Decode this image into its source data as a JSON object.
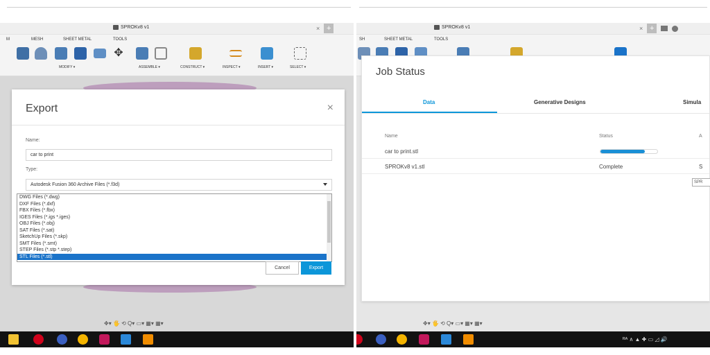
{
  "left_window": {
    "doc_title": "SPROKv8 v1",
    "close_glyph": "×",
    "new_tab_glyph": "+",
    "menu": [
      "M",
      "MESH",
      "SHEET METAL",
      "TOOLS"
    ],
    "toolbar_groups": [
      "MODIFY ▾",
      "ASSEMBLE ▾",
      "CONSTRUCT ▾",
      "INSPECT ▾",
      "INSERT ▾",
      "SELECT ▾"
    ],
    "nav_tools": "✥▾ 🖐 ⟲ Q▾ ▭▾ ▦▾ ▦▾"
  },
  "export_dialog": {
    "title": "Export",
    "close": "×",
    "name_label": "Name:",
    "name_value": "car to print",
    "type_label": "Type:",
    "type_value": "Autodesk Fusion 360 Archive Files (*.f3d)",
    "options": [
      "DWG Files (*.dwg)",
      "DXF Files (*.dxf)",
      "FBX Files (*.fbx)",
      "IGES Files (*.igs *.iges)",
      "OBJ Files (*.obj)",
      "SAT Files (*.sat)",
      "SketchUp Files (*.skp)",
      "SMT Files (*.smt)",
      "STEP Files (*.stp *.step)",
      "STL Files (*.stl)"
    ],
    "selected_index": 9,
    "cancel_label": "Cancel",
    "export_label": "Export"
  },
  "right_window": {
    "doc_title": "SPROKv8 v1",
    "close_glyph": "×",
    "new_tab_glyph": "+",
    "menu": [
      "SH",
      "SHEET METAL",
      "TOOLS"
    ]
  },
  "job_status": {
    "title": "Job Status",
    "tabs": [
      "Data",
      "Generative Designs",
      "Simula"
    ],
    "active_tab": 0,
    "col_name": "Name",
    "col_status": "Status",
    "col_extra": "A",
    "rows": [
      {
        "name": "car to print.stl",
        "status": "",
        "progress": 0.78,
        "extra": ""
      },
      {
        "name": "SPROKv8 v1.stl",
        "status": "Complete",
        "progress": null,
        "extra": "S"
      }
    ],
    "tag": "SPR"
  },
  "taskbar": {
    "tray_text": "ᴿᴬ ∧ ▲ ✚ ▭ ◿ 🔊"
  },
  "colors": {
    "accent": "#0c96d9",
    "selection": "#1a73c9",
    "taskbar": "#121212"
  }
}
